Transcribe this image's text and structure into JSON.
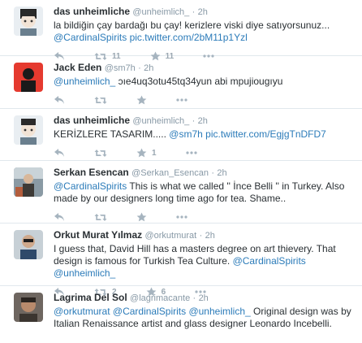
{
  "tweets": [
    {
      "name": "das unheimliche",
      "handle": "@unheimlich_",
      "time": "2h",
      "text": "la bildiğin çay bardağı bu çay! kerizlere viski diye satıyorsunuz...",
      "links": [
        "@CardinalSpirits",
        "pic.twitter.com/2bM11p1Yzl"
      ],
      "retweets": "11",
      "favorites": "11"
    },
    {
      "name": "Jack Eden",
      "handle": "@sm7h",
      "time": "2h",
      "lead": "@unheimlich_",
      "text": "ɔıe4uq3otu45tq34yun abi mpujiougıyu"
    },
    {
      "name": "das unheimliche",
      "handle": "@unheimlich_",
      "time": "2h",
      "text": "KERİZLERE TASARIM.....",
      "links": [
        "@sm7h",
        "pic.twitter.com/EgjgTnDFD7"
      ],
      "favorites": "1"
    },
    {
      "name": "Serkan Esencan",
      "handle": "@Serkan_Esencan",
      "time": "2h",
      "lead": "@CardinalSpirits",
      "text": "This is what we called '' İnce Belli '' in Turkey. Also made by our designers long time ago for tea. Shame.."
    },
    {
      "name": "Orkut Murat Yılmaz",
      "handle": "@orkutmurat",
      "time": "2h",
      "text": "I guess that, David Hill has a masters degree on art thievery. That design is famous for Turkish Tea Culture.",
      "links": [
        "@CardinalSpirits",
        "@unheimlich_"
      ],
      "retweets": "2",
      "favorites": "6"
    },
    {
      "name": "Lagrima Del Sol",
      "handle": "@lagrimacante",
      "time": "2h",
      "lead_links": [
        "@orkutmurat",
        "@CardinalSpirits",
        "@unheimlich_"
      ],
      "text": "Original design was by Italian Renaissance artist and glass designer Leonardo Incebelli."
    }
  ],
  "ui": {
    "dot": "·"
  },
  "icons": [
    "reply-icon",
    "retweet-icon",
    "favorite-icon",
    "more-icon"
  ]
}
